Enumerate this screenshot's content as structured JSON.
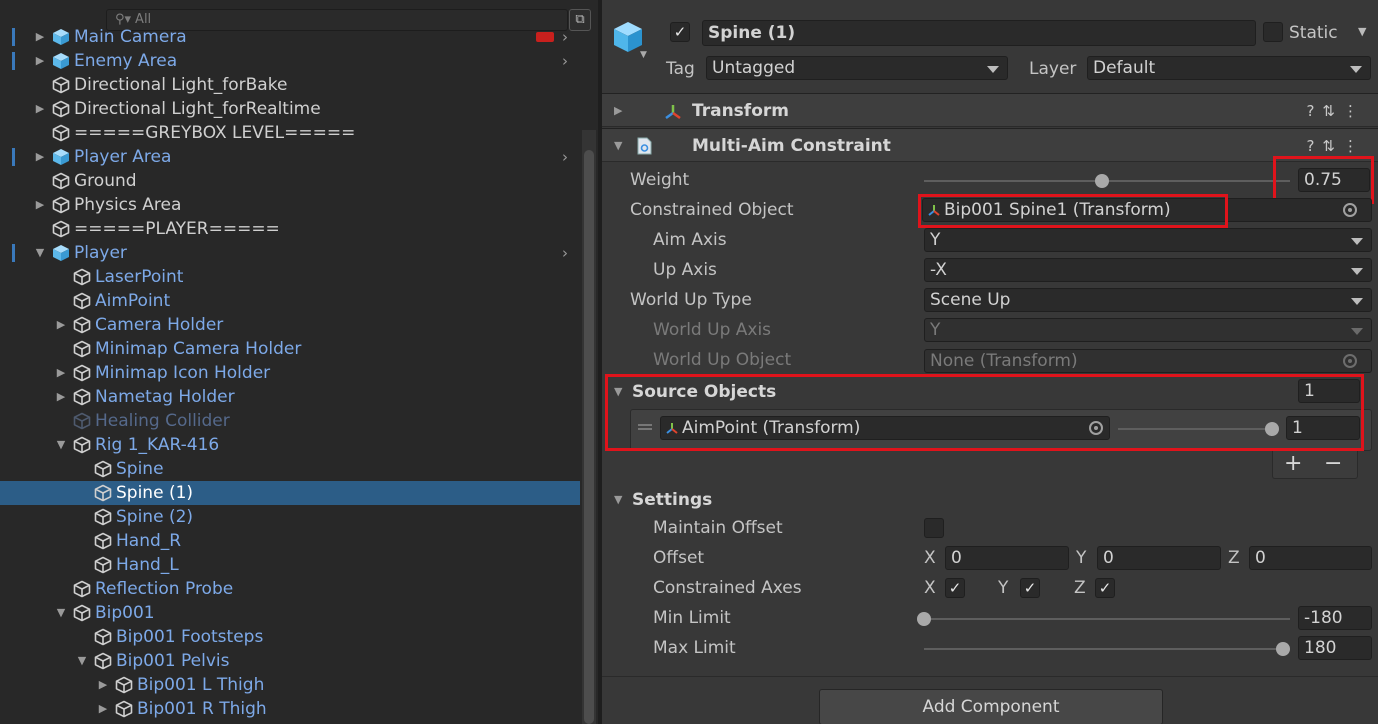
{
  "hierarchy": {
    "search_placeholder": "All",
    "rows": [
      {
        "label": "Main Camera",
        "type": "prefab",
        "color": "blue",
        "depth": 0,
        "arrow": true,
        "chevron": true,
        "marker": true,
        "flag": true
      },
      {
        "label": "Enemy Area",
        "type": "prefab",
        "color": "blue",
        "depth": 0,
        "arrow": true,
        "chevron": true,
        "marker": true
      },
      {
        "label": "Directional Light_forBake",
        "type": "object",
        "color": "white",
        "depth": 0,
        "arrow": false
      },
      {
        "label": "Directional Light_forRealtime",
        "type": "object",
        "color": "white",
        "depth": 0,
        "arrow": true
      },
      {
        "label": "=====GREYBOX LEVEL=====",
        "type": "object",
        "color": "white",
        "depth": 0,
        "arrow": false
      },
      {
        "label": "Player Area",
        "type": "prefab",
        "color": "blue",
        "depth": 0,
        "arrow": true,
        "chevron": true,
        "marker": true
      },
      {
        "label": "Ground",
        "type": "object",
        "color": "white",
        "depth": 0,
        "arrow": false
      },
      {
        "label": "Physics Area",
        "type": "object",
        "color": "white",
        "depth": 0,
        "arrow": true
      },
      {
        "label": "=====PLAYER=====",
        "type": "object",
        "color": "white",
        "depth": 0,
        "arrow": false
      },
      {
        "label": "Player",
        "type": "prefab",
        "color": "blue",
        "depth": 0,
        "arrow": true,
        "expanded": true,
        "chevron": true,
        "marker": true
      },
      {
        "label": "LaserPoint",
        "type": "object",
        "color": "blue",
        "depth": 1,
        "arrow": false
      },
      {
        "label": "AimPoint",
        "type": "object",
        "color": "blue",
        "depth": 1,
        "arrow": false
      },
      {
        "label": "Camera Holder",
        "type": "object",
        "color": "blue",
        "depth": 1,
        "arrow": true
      },
      {
        "label": "Minimap Camera Holder",
        "type": "object",
        "color": "blue",
        "depth": 1,
        "arrow": false
      },
      {
        "label": "Minimap Icon Holder",
        "type": "object",
        "color": "blue",
        "depth": 1,
        "arrow": true
      },
      {
        "label": "Nametag Holder",
        "type": "object",
        "color": "blue",
        "depth": 1,
        "arrow": true
      },
      {
        "label": "Healing Collider",
        "type": "object",
        "color": "dim",
        "depth": 1,
        "arrow": false
      },
      {
        "label": "Rig 1_KAR-416",
        "type": "object",
        "color": "blue",
        "depth": 1,
        "arrow": true,
        "expanded": true
      },
      {
        "label": "Spine",
        "type": "object",
        "color": "blue",
        "depth": 2,
        "arrow": false
      },
      {
        "label": "Spine (1)",
        "type": "object",
        "color": "blue",
        "depth": 2,
        "arrow": false,
        "selected": true
      },
      {
        "label": "Spine (2)",
        "type": "object",
        "color": "blue",
        "depth": 2,
        "arrow": false
      },
      {
        "label": "Hand_R",
        "type": "object",
        "color": "blue",
        "depth": 2,
        "arrow": false
      },
      {
        "label": "Hand_L",
        "type": "object",
        "color": "blue",
        "depth": 2,
        "arrow": false
      },
      {
        "label": "Reflection Probe",
        "type": "object",
        "color": "blue",
        "depth": 1,
        "arrow": false
      },
      {
        "label": "Bip001",
        "type": "object",
        "color": "blue",
        "depth": 1,
        "arrow": true,
        "expanded": true
      },
      {
        "label": "Bip001 Footsteps",
        "type": "object",
        "color": "blue",
        "depth": 2,
        "arrow": false
      },
      {
        "label": "Bip001 Pelvis",
        "type": "object",
        "color": "blue",
        "depth": 2,
        "arrow": true,
        "expanded": true
      },
      {
        "label": "Bip001 L Thigh",
        "type": "object",
        "color": "blue",
        "depth": 3,
        "arrow": true
      },
      {
        "label": "Bip001 R Thigh",
        "type": "object",
        "color": "blue",
        "depth": 3,
        "arrow": true
      }
    ]
  },
  "inspector": {
    "object_name": "Spine (1)",
    "active_check": "✓",
    "static_label": "Static",
    "tag_label": "Tag",
    "tag_value": "Untagged",
    "layer_label": "Layer",
    "layer_value": "Default",
    "transform_title": "Transform",
    "constraint_title": "Multi-Aim Constraint",
    "header_icons": "?⇅⋮",
    "weight_label": "Weight",
    "weight_value": "0.75",
    "weight_fraction": 0.75,
    "constrained_object_label": "Constrained Object",
    "constrained_object_value": "Bip001 Spine1 (Transform)",
    "aim_axis_label": "Aim Axis",
    "aim_axis_value": "Y",
    "up_axis_label": "Up Axis",
    "up_axis_value": "-X",
    "world_up_type_label": "World Up Type",
    "world_up_type_value": "Scene Up",
    "world_up_axis_label": "World Up Axis",
    "world_up_axis_value": "Y",
    "world_up_object_label": "World Up Object",
    "world_up_object_value": "None (Transform)",
    "source_objects_label": "Source Objects",
    "source_objects_count": "1",
    "source_item_value": "AimPoint (Transform)",
    "source_item_weight": "1",
    "source_item_fraction": 1,
    "add_symbol": "+",
    "remove_symbol": "−",
    "settings_label": "Settings",
    "maintain_offset_label": "Maintain Offset",
    "offset_label": "Offset",
    "offset_x_label": "X",
    "offset_x": "0",
    "offset_y_label": "Y",
    "offset_y": "0",
    "offset_z_label": "Z",
    "offset_z": "0",
    "constrained_axes_label": "Constrained Axes",
    "axis_x_label": "X",
    "axis_y_label": "Y",
    "axis_z_label": "Z",
    "axis_check": "✓",
    "min_limit_label": "Min Limit",
    "min_limit_value": "-180",
    "min_fraction": 0,
    "max_limit_label": "Max Limit",
    "max_limit_value": "180",
    "max_fraction": 1,
    "add_component_label": "Add Component"
  },
  "colors": {
    "selection": "#2c5d87",
    "prefab_text": "#7da9e8",
    "highlight_box": "#e0131b"
  }
}
